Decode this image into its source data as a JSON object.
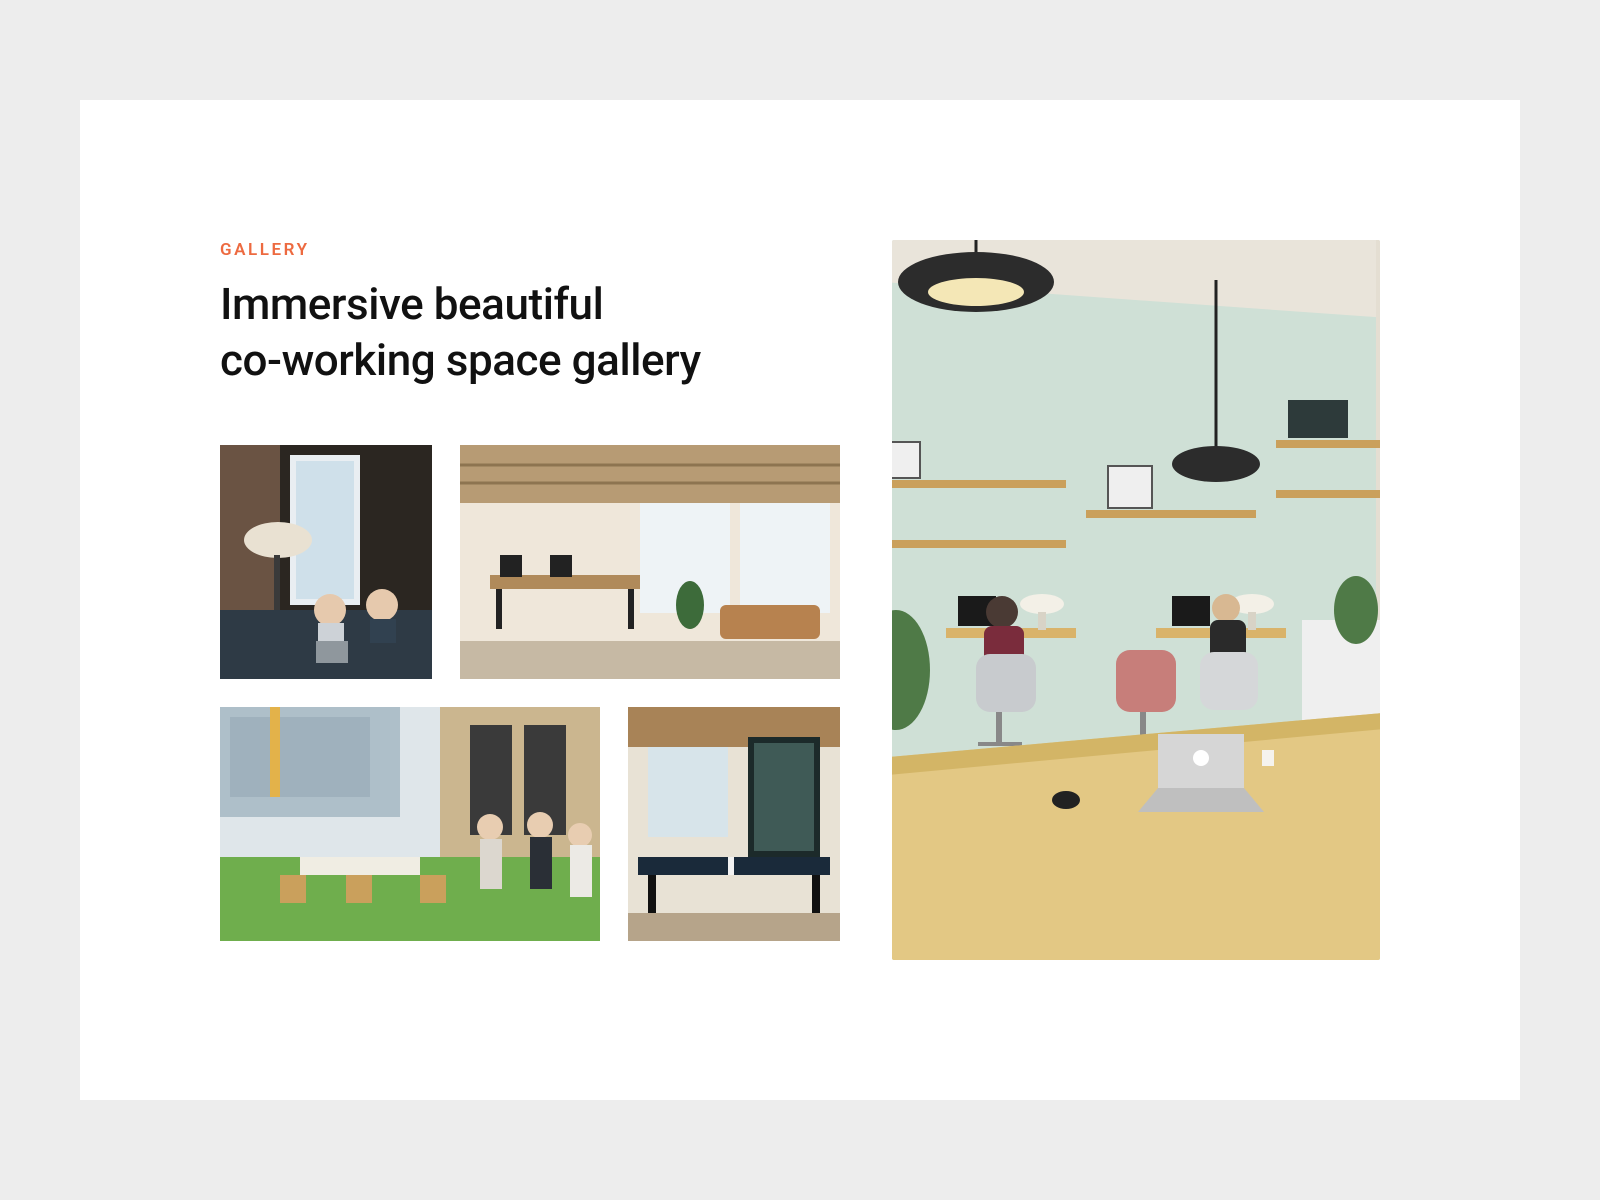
{
  "eyebrow": "GALLERY",
  "title_line1": "Immersive beautiful",
  "title_line2": "co-working space gallery",
  "colors": {
    "accent": "#ed6a40",
    "text": "#111111",
    "page_bg": "#ededed",
    "card_bg": "#ffffff"
  },
  "thumbnails": [
    {
      "name": "lounge-window",
      "desc": "two people with laptops on a sofa by a tall window, brick wall, floor lamp"
    },
    {
      "name": "open-office",
      "desc": "open-plan desks, exposed ceiling, bright windows, plants, couches"
    },
    {
      "name": "terrace",
      "desc": "outdoor terrace with artificial grass, wooden chairs, people standing"
    },
    {
      "name": "games-room",
      "desc": "ping-pong table in front of large industrial windows, brick wall"
    }
  ],
  "hero": {
    "name": "mint-coworking-room",
    "desc": "large mint-green room, two pendant dome lights, wall shelves with frames, two people at desks with chairs, big wooden table with laptop in foreground"
  }
}
